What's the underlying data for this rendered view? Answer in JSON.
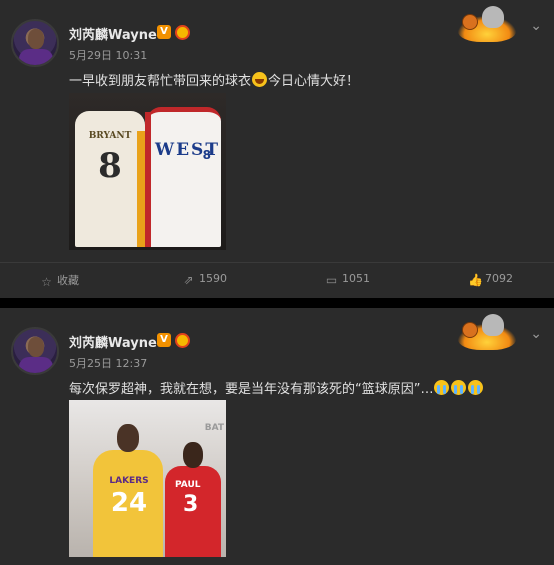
{
  "posts": [
    {
      "user": {
        "name": "刘芮麟Wayne",
        "verified_badge": "V"
      },
      "time": "5月29日 10:31",
      "text_before_emoji": "一早收到朋友帮忙带回来的球衣",
      "text_after_emoji": "今日心情大好！",
      "image": {
        "jersey_left_name": "BRYANT",
        "jersey_left_number": "8",
        "jersey_right_text": "WEST",
        "jersey_right_number": "8"
      },
      "actions": {
        "favorite_label": "收藏",
        "repost_count": "1590",
        "comment_count": "1051",
        "like_count": "7092"
      }
    },
    {
      "user": {
        "name": "刘芮麟Wayne",
        "verified_badge": "V"
      },
      "time": "5月25日 12:37",
      "text": "每次保罗超神，我就在想，要是当年没有那该死的“篮球原因”…",
      "image": {
        "corner_text": "BAT",
        "left_team": "LAKERS",
        "left_number": "24",
        "right_name": "PAUL",
        "right_number": "3"
      }
    }
  ],
  "icons": {
    "favorite": "star-icon",
    "repost": "repost-icon",
    "comment": "comment-icon",
    "like": "thumbs-up-icon",
    "menu": "chevron-down-icon"
  },
  "colors": {
    "background": "#000000",
    "card": "#2b2b2b",
    "verified": "#f29100",
    "text": "#e0e0e0",
    "muted": "#9a9a9a"
  }
}
